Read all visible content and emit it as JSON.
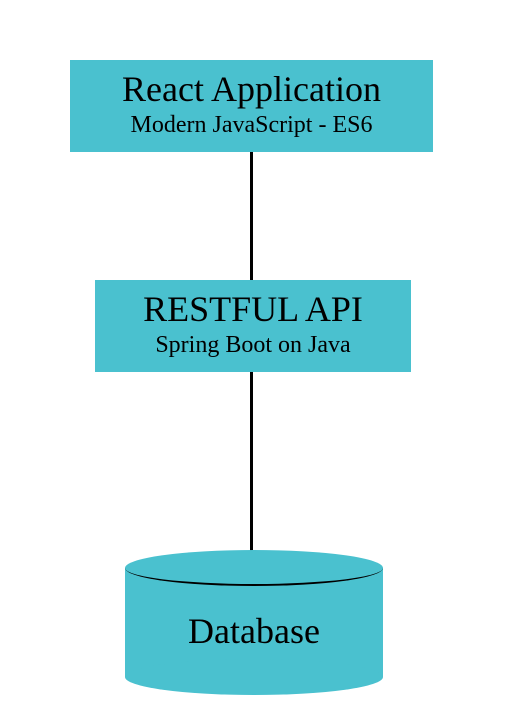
{
  "colors": {
    "box_fill": "#4ac1cf",
    "connector": "#000000"
  },
  "nodes": {
    "frontend": {
      "title": "React Application",
      "subtitle": "Modern JavaScript - ES6"
    },
    "api": {
      "title": "RESTFUL API",
      "subtitle": "Spring Boot on Java"
    },
    "database": {
      "title": "Database"
    }
  }
}
